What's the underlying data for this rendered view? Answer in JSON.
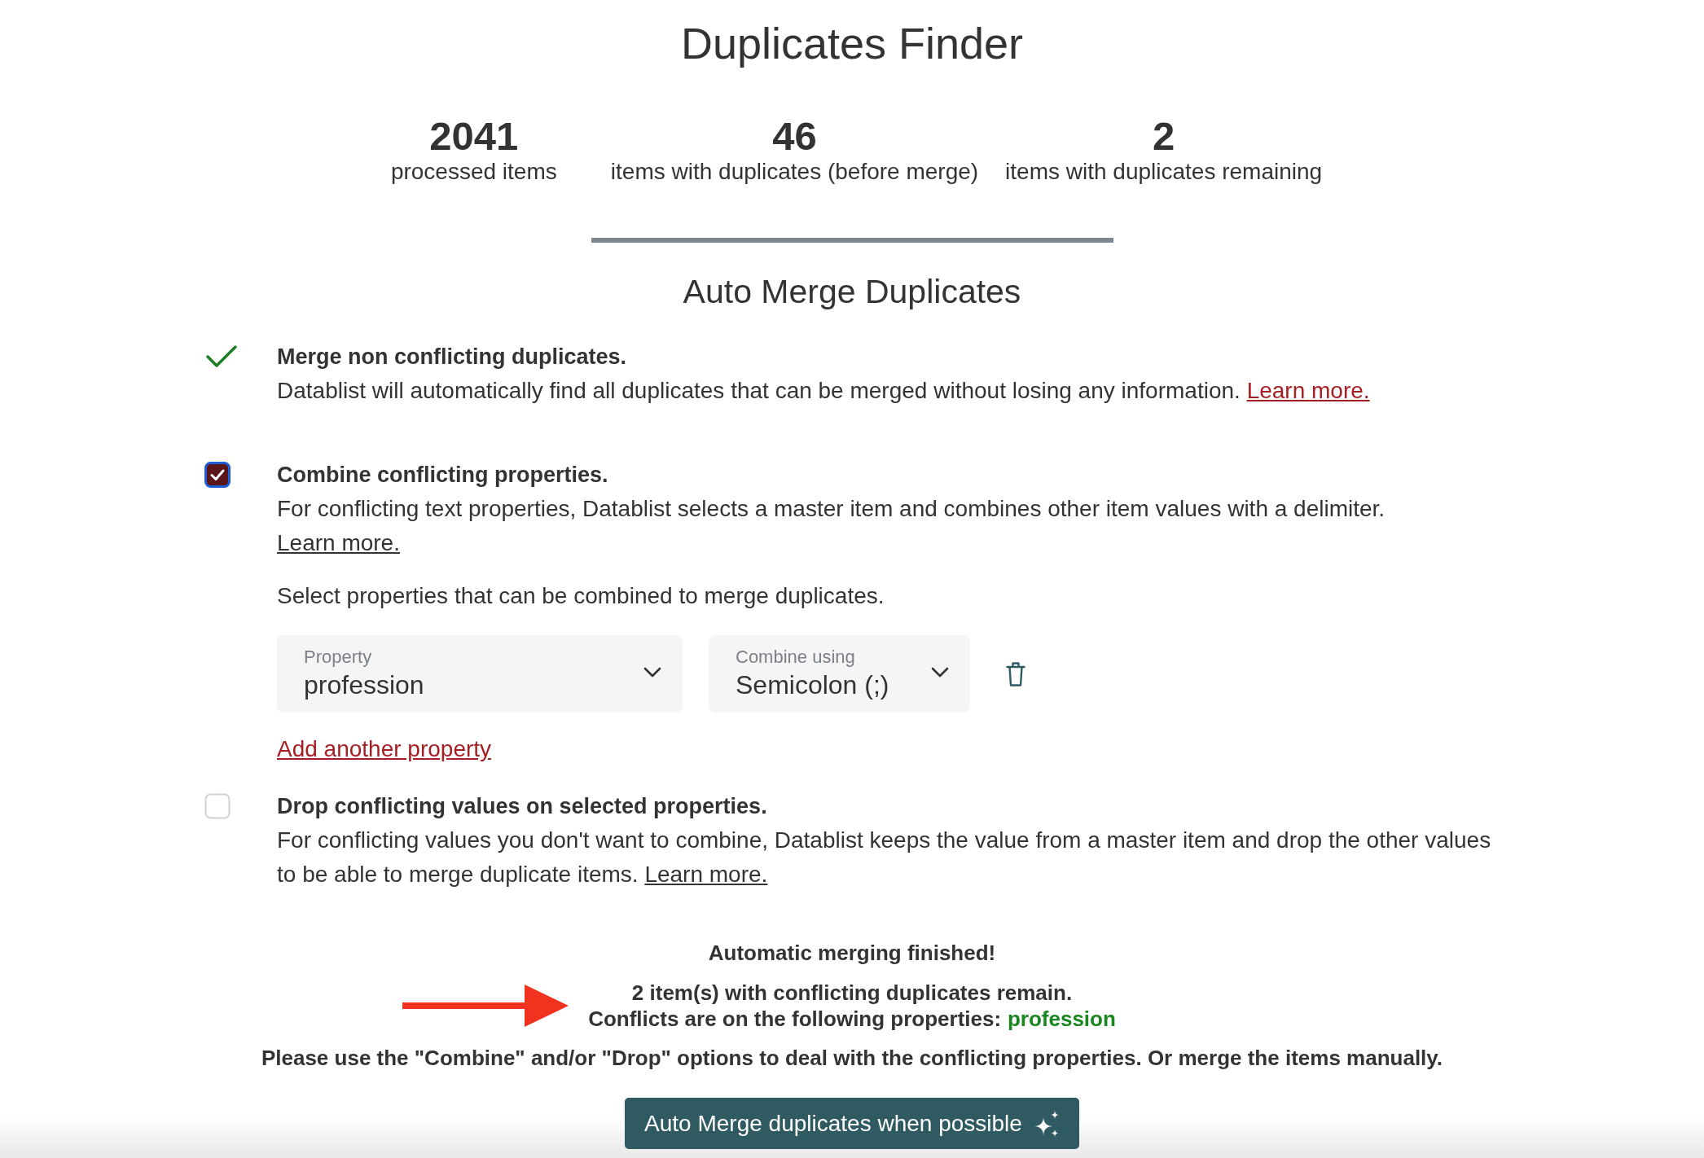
{
  "title": "Duplicates Finder",
  "stats": [
    {
      "value": "2041",
      "label": "processed items"
    },
    {
      "value": "46",
      "label": "items with duplicates (before merge)"
    },
    {
      "value": "2",
      "label": "items with duplicates remaining"
    }
  ],
  "section_title": "Auto Merge Duplicates",
  "options": [
    {
      "kind": "done",
      "title": "Merge non conflicting duplicates.",
      "description": "Datablist will automatically find all duplicates that can be merged without losing any information.",
      "link": {
        "label": "Learn more.",
        "highlighted": true
      }
    },
    {
      "kind": "checkbox",
      "checked": true,
      "focused": true,
      "title": "Combine conflicting properties.",
      "description": "For conflicting text properties, Datablist selects a master item and combines other item values with a delimiter.",
      "link": {
        "label": "Learn more.",
        "highlighted": false
      },
      "prompt": "Select properties that can be combined to merge duplicates.",
      "rules": [
        {
          "property": {
            "label": "Property",
            "value": "profession"
          },
          "delimiter": {
            "label": "Combine using",
            "value": "Semicolon (;)"
          }
        }
      ],
      "add_link": "Add another property"
    },
    {
      "kind": "checkbox",
      "checked": false,
      "focused": false,
      "title": "Drop conflicting values on selected properties.",
      "description": "For conflicting values you don't want to combine, Datablist keeps the value from a master item and drop the other values to be able to merge duplicate items.",
      "link": {
        "label": "Learn more.",
        "highlighted": false
      }
    }
  ],
  "result": {
    "heading": "Automatic merging finished!",
    "remaining": "2 item(s) with conflicting duplicates remain.",
    "conflicts_label": "Conflicts are on the following properties:",
    "conflict_properties": [
      "profession"
    ],
    "advice": "Please use the \"Combine\" and/or \"Drop\" options to deal with the conflicting properties. Or merge the items manually."
  },
  "button": {
    "label": "Auto Merge duplicates when possible"
  }
}
